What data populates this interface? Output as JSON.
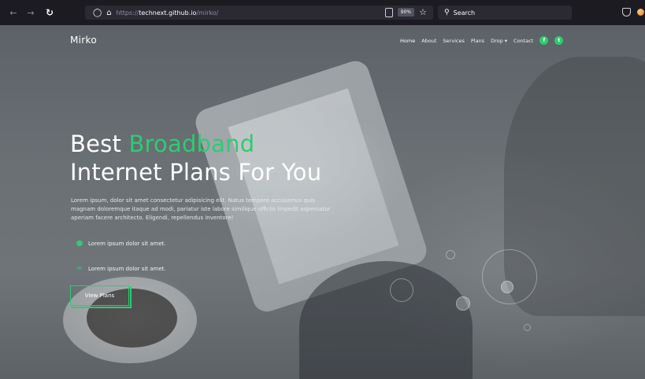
{
  "browser": {
    "back_icon": "arrow-left-icon",
    "forward_icon": "arrow-right-icon",
    "reload_icon": "reload-icon",
    "url_prefix": "https://",
    "url_host": "technext.github.io",
    "url_path": "/mirko/",
    "zoom": "90%",
    "search_placeholder": "Search"
  },
  "site": {
    "logo": "Mirko",
    "nav": [
      {
        "label": "Home"
      },
      {
        "label": "About"
      },
      {
        "label": "Services"
      },
      {
        "label": "Plans"
      },
      {
        "label": "Drop ▾"
      },
      {
        "label": "Contact"
      }
    ],
    "social": {
      "facebook": "f",
      "twitter": "t"
    }
  },
  "hero": {
    "headline_word1": "Best",
    "headline_accent": "Broadband",
    "headline_line2": "Internet Plans For You",
    "lead": "Lorem ipsum, dolor sit amet consectetur adipisicing elit. Natus tempore accusamus quis magnam doloremque itaque ad modi, pariatur iste labore similique officiis impedit aspernatur aperiam facere architecto. Eligendi, repellendus inventore!",
    "features": [
      {
        "text": "Lorem ipsum dolor sit amet.",
        "icon": "chat-icon"
      },
      {
        "text": "Lorem ipsum dolor sit amet.",
        "icon": "wifi-icon"
      }
    ],
    "cta": "View Plans"
  },
  "colors": {
    "accent": "#2ecc71",
    "browser_bg": "#1c1b22"
  }
}
